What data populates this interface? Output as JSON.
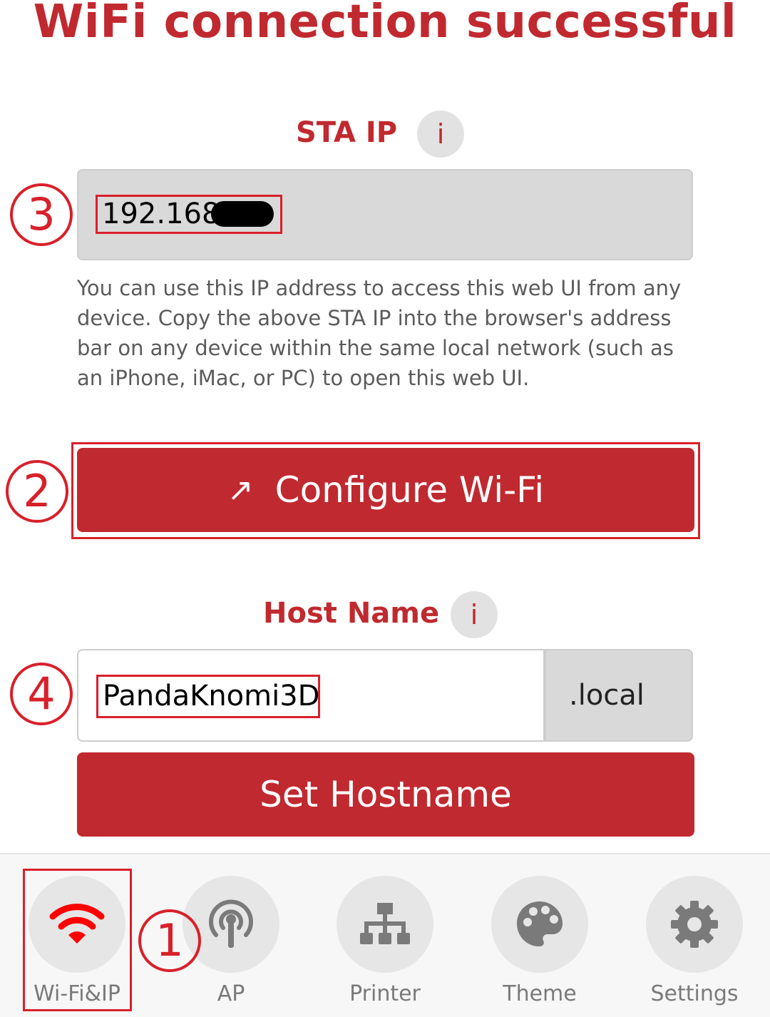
{
  "title": "WiFi connection successful",
  "sta_ip": {
    "label": "STA IP",
    "info_glyph": "i",
    "value": "192.168.",
    "description": "You can use this IP address to access this web UI from any device. Copy the above STA IP into the browser's address bar on any device within the same local network (such as an iPhone, iMac, or PC) to open this web UI."
  },
  "configure_wifi": {
    "arrow": "↗",
    "label": "Configure Wi-Fi"
  },
  "host_name": {
    "label": "Host Name",
    "info_glyph": "i",
    "value": "PandaKnomi3D",
    "suffix": ".local",
    "set_button": "Set Hostname"
  },
  "annotations": {
    "step1": "1",
    "step2": "2",
    "step3": "3",
    "step4": "4"
  },
  "nav": {
    "items": [
      {
        "label": "Wi-Fi&IP",
        "icon": "wifi-icon",
        "active": true
      },
      {
        "label": "AP",
        "icon": "antenna-icon",
        "active": false
      },
      {
        "label": "Printer",
        "icon": "network-tree-icon",
        "active": false
      },
      {
        "label": "Theme",
        "icon": "palette-icon",
        "active": false
      },
      {
        "label": "Settings",
        "icon": "gear-icon",
        "active": false
      }
    ]
  },
  "colors": {
    "accent": "#c0292f",
    "annotation_red": "#d8202a",
    "wifi_active": "#ff0000",
    "icon_inactive": "#7a7a7a",
    "field_bg": "#d9d9d9"
  }
}
